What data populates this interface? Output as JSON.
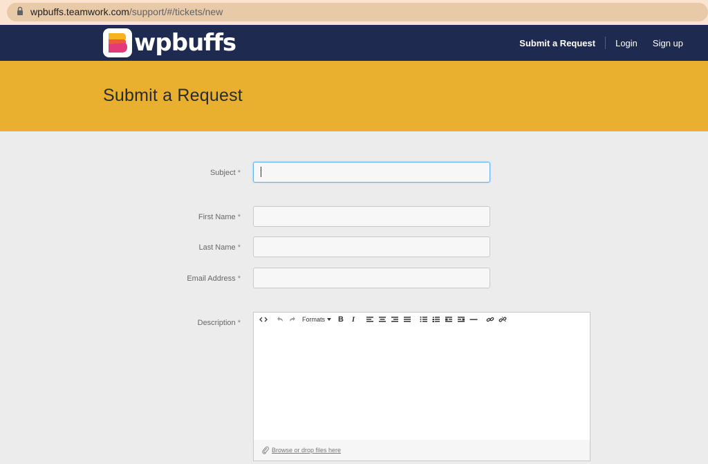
{
  "browser": {
    "url_host": "wpbuffs.teamwork.com",
    "url_path": "/support/#/tickets/new"
  },
  "header": {
    "logo_text": "wpbuffs",
    "nav": {
      "submit": "Submit a Request",
      "login": "Login",
      "signup": "Sign up"
    }
  },
  "hero": {
    "title": "Submit a Request"
  },
  "form": {
    "subject": {
      "label": "Subject",
      "req": "*",
      "value": ""
    },
    "first_name": {
      "label": "First Name",
      "req": "*",
      "value": ""
    },
    "last_name": {
      "label": "Last Name",
      "req": "*",
      "value": ""
    },
    "email": {
      "label": "Email Address",
      "req": "*",
      "value": ""
    },
    "description": {
      "label": "Description",
      "req": "*"
    }
  },
  "editor": {
    "formats_label": "Formats",
    "bold": "B",
    "italic": "I",
    "attach_link": "Browse or drop files here"
  },
  "colors": {
    "header_bg": "#1e2a4f",
    "hero_bg": "#e9b030",
    "page_bg": "#ececec"
  }
}
